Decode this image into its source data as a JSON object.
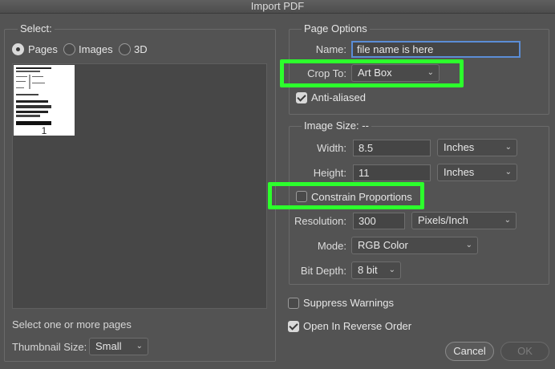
{
  "window": {
    "title": "Import PDF"
  },
  "select_panel": {
    "title": "Select:",
    "radios": [
      {
        "label": "Pages",
        "selected": true
      },
      {
        "label": "Images",
        "selected": false
      },
      {
        "label": "3D",
        "selected": false
      }
    ],
    "thumbnails": [
      {
        "page_number": "1"
      }
    ],
    "hint": "Select one or more pages",
    "thumbnail_size": {
      "label": "Thumbnail Size:",
      "value": "Small"
    }
  },
  "page_options": {
    "title": "Page Options",
    "name": {
      "label": "Name:",
      "value": "file name is here"
    },
    "crop_to": {
      "label": "Crop To:",
      "value": "Art Box"
    },
    "anti_aliased": {
      "label": "Anti-aliased",
      "checked": true
    }
  },
  "image_size": {
    "title": "Image Size: --",
    "width": {
      "label": "Width:",
      "value": "8.5",
      "unit": "Inches"
    },
    "height": {
      "label": "Height:",
      "value": "11",
      "unit": "Inches"
    },
    "constrain": {
      "label": "Constrain Proportions",
      "checked": false
    },
    "resolution": {
      "label": "Resolution:",
      "value": "300",
      "unit": "Pixels/Inch"
    },
    "mode": {
      "label": "Mode:",
      "value": "RGB Color"
    },
    "bit_depth": {
      "label": "Bit Depth:",
      "value": "8 bit"
    }
  },
  "options": {
    "suppress_warnings": {
      "label": "Suppress Warnings",
      "checked": false
    },
    "reverse_order": {
      "label": "Open In Reverse Order",
      "checked": true
    }
  },
  "buttons": {
    "cancel": "Cancel",
    "ok": "OK"
  },
  "colors": {
    "background": "#535353",
    "highlight": "#2cff2c",
    "focus": "#5b8dd6"
  }
}
